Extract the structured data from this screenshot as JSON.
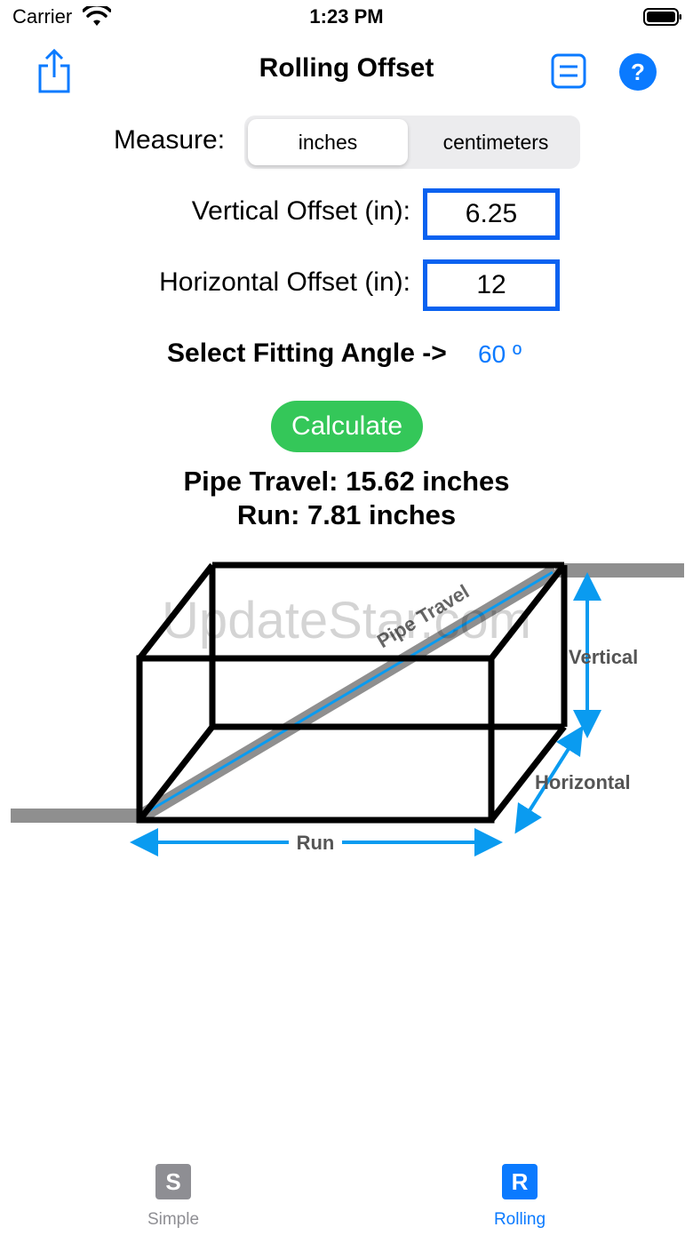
{
  "status_bar": {
    "carrier": "Carrier",
    "time": "1:23 PM"
  },
  "nav": {
    "title": "Rolling Offset"
  },
  "measure": {
    "label": "Measure:",
    "options": [
      "inches",
      "centimeters"
    ],
    "selected": "inches"
  },
  "inputs": {
    "vertical": {
      "label": "Vertical Offset (in):",
      "value": "6.25"
    },
    "horizontal": {
      "label": "Horizontal Offset (in):",
      "value": "12"
    }
  },
  "angle": {
    "label": "Select Fitting Angle ->",
    "value": "60 º"
  },
  "calculate_label": "Calculate",
  "results": {
    "pipe_travel": "Pipe Travel: 15.62 inches",
    "run": "Run: 7.81 inches"
  },
  "diagram": {
    "labels": {
      "pipe_travel": "Pipe Travel",
      "vertical": "Vertical",
      "horizontal": "Horizontal",
      "run": "Run"
    },
    "watermark": "UpdateStar.com"
  },
  "tabs": [
    {
      "letter": "S",
      "label": "Simple",
      "active": false
    },
    {
      "letter": "R",
      "label": "Rolling",
      "active": true
    }
  ],
  "colors": {
    "accent": "#0a7aff",
    "calculate": "#34c759",
    "tab_inactive": "#8e8e93",
    "pipe": "#8f8f8f"
  }
}
